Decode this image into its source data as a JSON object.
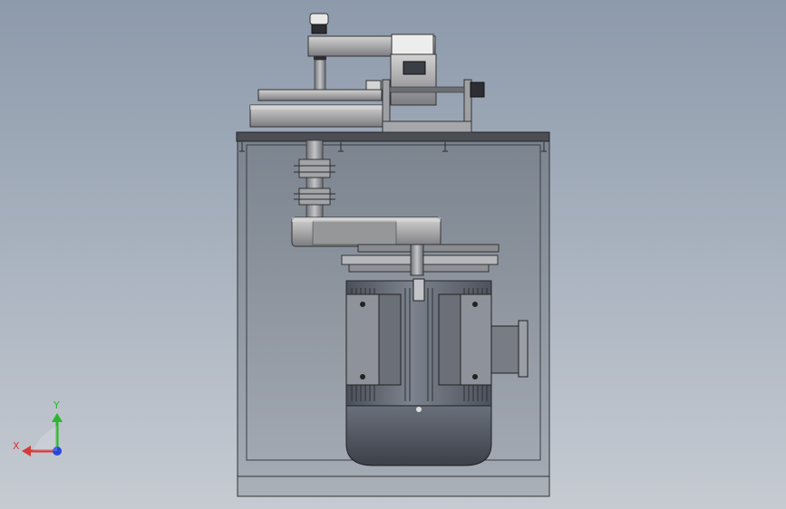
{
  "viewport": {
    "background_top": "#8d9aab",
    "background_bottom": "#c6cbd2"
  },
  "model": {
    "description_icon": "mechanical-assembly-icon",
    "colors": {
      "frame_top": "#4e5157",
      "cabinet_fill": "#8b939d",
      "metal_light": "#b9b9b9",
      "metal_mid": "#8e9095",
      "metal_dark": "#3f4248",
      "motor_body": "#5a5f69"
    }
  },
  "triad": {
    "x_label": "X",
    "y_label": "Y",
    "x_color": "#d33a3a",
    "y_color": "#2db62d",
    "z_color": "#2747d8"
  }
}
